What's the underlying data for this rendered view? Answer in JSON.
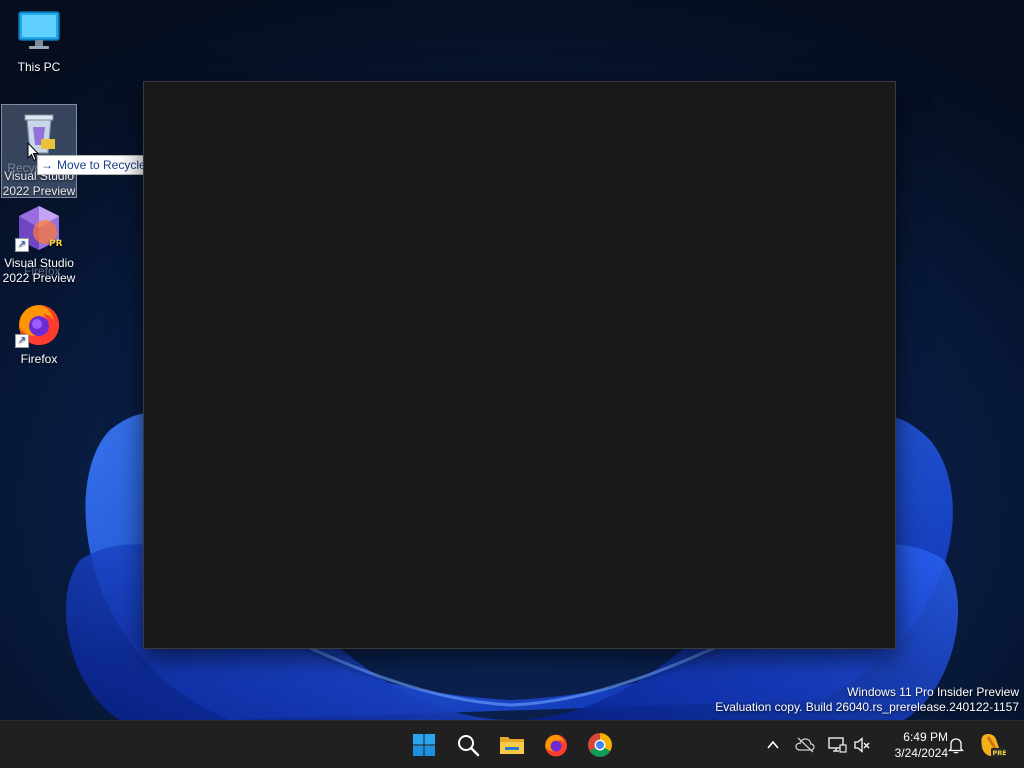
{
  "desktop": {
    "icons": [
      {
        "label": "This PC",
        "icon": "monitor-icon"
      },
      {
        "label": "Recycle Bin",
        "icon": "recycle-bin-icon"
      },
      {
        "label": "Visual Studio 2022 Preview",
        "icon": "visual-studio-preview-icon"
      },
      {
        "label": "Firefox",
        "icon": "firefox-icon"
      }
    ],
    "drag_ghost": {
      "label": "Visual Studio 2022 Preview",
      "sub_label": "Firefox"
    },
    "tooltip": {
      "arrow": "→",
      "text": "Move to Recycle Bin"
    },
    "watermark": {
      "line1": "Windows 11 Pro Insider Preview",
      "line2": "Evaluation copy. Build 26040.rs_prerelease.240122-1157"
    }
  },
  "taskbar": {
    "pinned": [
      {
        "name": "start-button",
        "icon": "windows-logo-icon"
      },
      {
        "name": "search-button",
        "icon": "search-icon"
      },
      {
        "name": "file-explorer-button",
        "icon": "folder-icon"
      },
      {
        "name": "firefox-taskbar-button",
        "icon": "firefox-icon"
      },
      {
        "name": "chrome-taskbar-button",
        "icon": "chrome-icon"
      }
    ],
    "tray": {
      "time": "6:49 PM",
      "date": "3/24/2024"
    }
  },
  "colors": {
    "accent": "#0078d4",
    "taskbar_bg": "#202020",
    "window_bg": "#191919"
  }
}
